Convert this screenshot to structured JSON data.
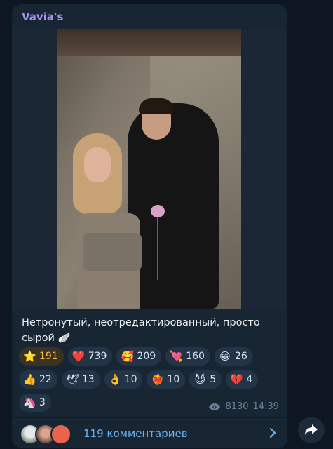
{
  "post": {
    "channel_name": "Vavia's",
    "caption": "Нетронутый, неотредактированный, просто сырой 🪽",
    "views": "8130",
    "time": "14:39",
    "comments_label": "119 комментариев"
  },
  "reactions": [
    {
      "emoji": "⭐",
      "count": "191",
      "paid": true
    },
    {
      "emoji": "❤️",
      "count": "739"
    },
    {
      "emoji": "🥰",
      "count": "209"
    },
    {
      "emoji": "💘",
      "count": "160"
    },
    {
      "emoji": "😁",
      "count": "26"
    },
    {
      "emoji": "👍",
      "count": "22"
    },
    {
      "emoji": "🕊",
      "count": "13"
    },
    {
      "emoji": "👌",
      "count": "10"
    },
    {
      "emoji": "❤️‍🔥",
      "count": "10"
    },
    {
      "emoji": "😈",
      "count": "5"
    },
    {
      "emoji": "💔",
      "count": "4"
    },
    {
      "emoji": "🦄",
      "count": "3"
    }
  ],
  "icons": {
    "views": "eye-icon",
    "comments_arrow": "chevron-right-icon",
    "share": "share-arrow-icon"
  },
  "colors": {
    "background": "#0e1621",
    "bubble": "#182533",
    "channel_name": "#a694f5",
    "link": "#6ab3f3",
    "paid_star": "#f4bd4a"
  }
}
